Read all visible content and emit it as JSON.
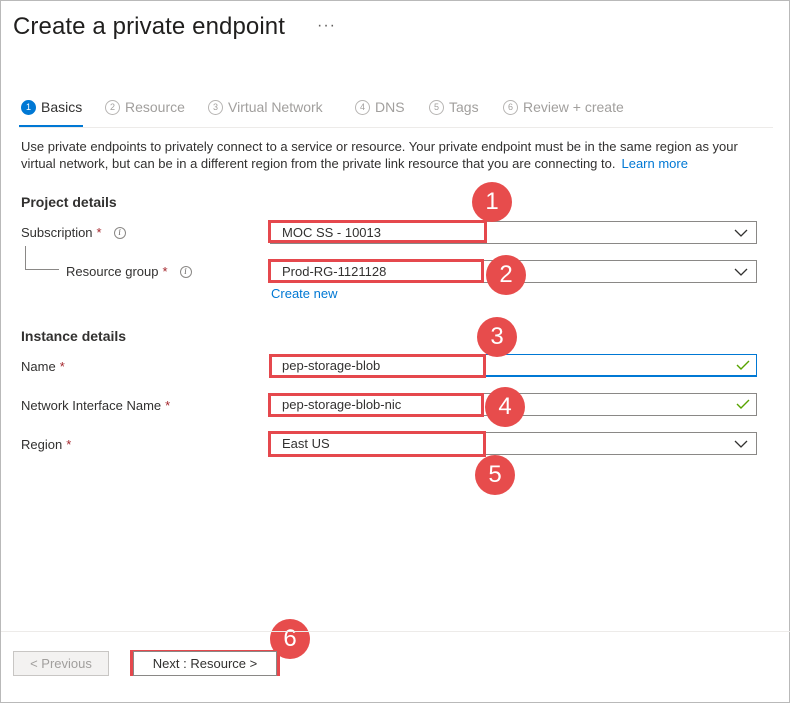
{
  "page": {
    "title": "Create a private endpoint",
    "more_icon": "···"
  },
  "tabs": [
    {
      "num": "1",
      "label": "Basics",
      "active": true
    },
    {
      "num": "2",
      "label": "Resource",
      "active": false
    },
    {
      "num": "3",
      "label": "Virtual Network",
      "active": false
    },
    {
      "num": "4",
      "label": "DNS",
      "active": false
    },
    {
      "num": "5",
      "label": "Tags",
      "active": false
    },
    {
      "num": "6",
      "label": "Review + create",
      "active": false
    }
  ],
  "description": {
    "text": "Use private endpoints to privately connect to a service or resource. Your private endpoint must be in the same region as your virtual network, but can be in a different region from the private link resource that you are connecting to.",
    "learn_more": "Learn more"
  },
  "project_details": {
    "heading": "Project details",
    "subscription": {
      "label": "Subscription",
      "required": "*",
      "value": "MOC SS - 10013",
      "icon": "info-icon"
    },
    "resource_group": {
      "label": "Resource group",
      "required": "*",
      "value": "Prod-RG-1121128",
      "icon": "info-icon",
      "create_new": "Create new"
    }
  },
  "instance_details": {
    "heading": "Instance details",
    "name": {
      "label": "Name",
      "required": "*",
      "value": "pep-storage-blob"
    },
    "nic_name": {
      "label": "Network Interface Name",
      "required": "*",
      "value": "pep-storage-blob-nic"
    },
    "region": {
      "label": "Region",
      "required": "*",
      "value": "East US"
    }
  },
  "annotations": {
    "badges": [
      "1",
      "2",
      "3",
      "4",
      "5",
      "6"
    ],
    "color": "#e74c4c"
  },
  "footer": {
    "previous": "< Previous",
    "next": "Next : Resource >"
  },
  "colors": {
    "accent": "#0078d4",
    "required": "#a4262c",
    "valid_check": "#57a300"
  }
}
